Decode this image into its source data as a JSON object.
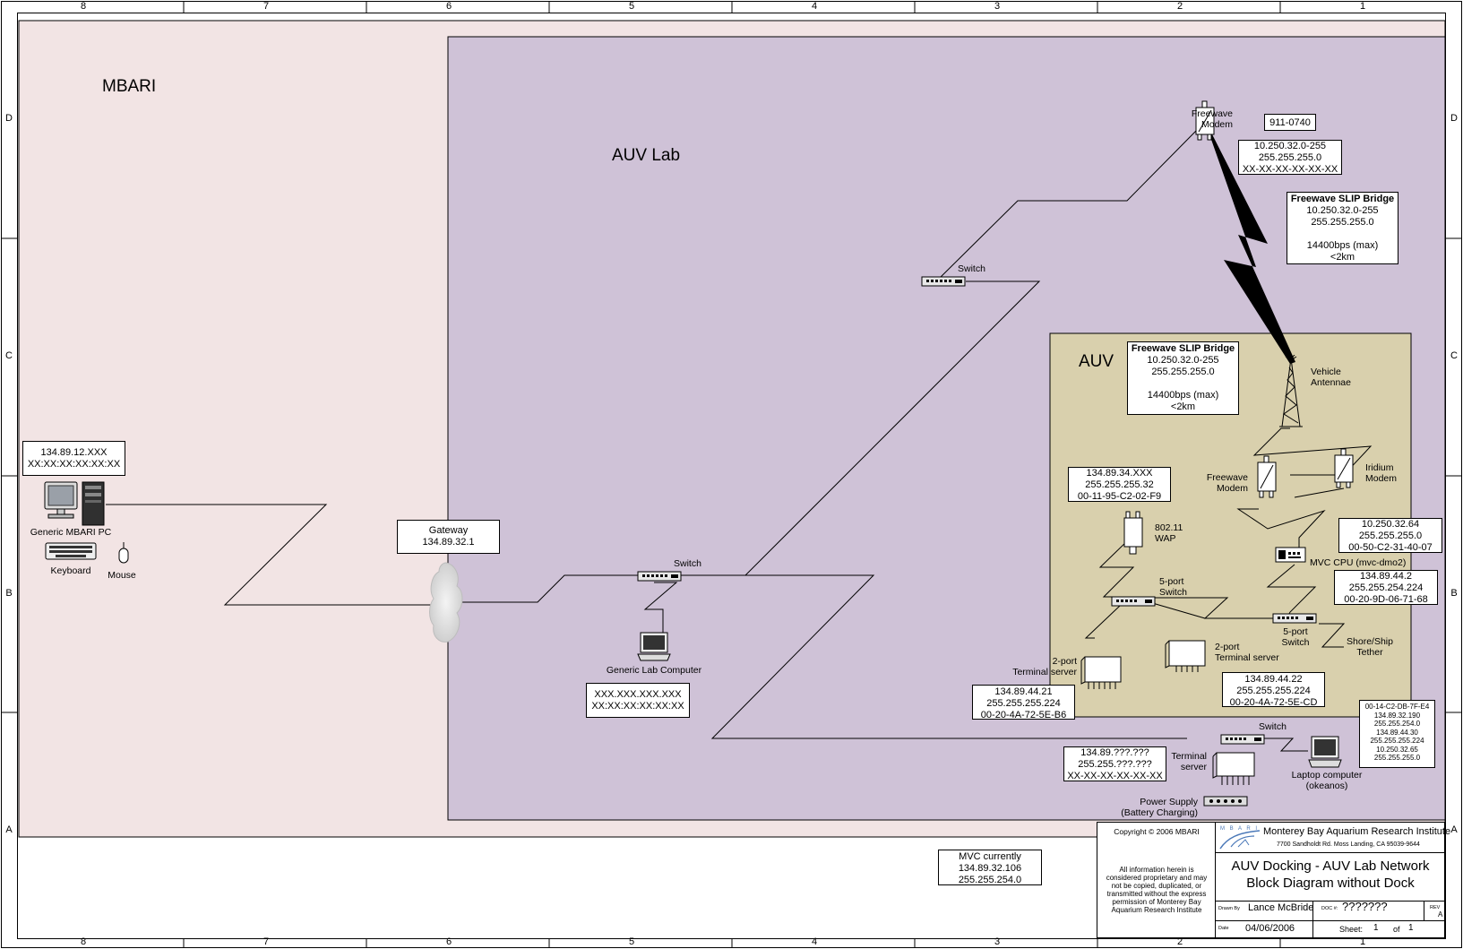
{
  "grid": {
    "columns": [
      "8",
      "7",
      "6",
      "5",
      "4",
      "3",
      "2",
      "1"
    ],
    "rows": [
      "D",
      "C",
      "B",
      "A"
    ]
  },
  "zones": {
    "mbari": "MBARI",
    "auv_lab": "AUV Lab",
    "auv": "AUV"
  },
  "colors": {
    "mbari_zone": "#f2e4e4",
    "auv_lab_zone": "#cfc2d7",
    "auv_zone": "#d9d0ad"
  },
  "mbari_pc": {
    "info": [
      "134.89.12.XXX",
      "XX:XX:XX:XX:XX:XX"
    ],
    "pc_label": "Generic MBARI PC",
    "keyboard_label": "Keyboard",
    "mouse_label": "Mouse"
  },
  "gateway": {
    "info": [
      "Gateway",
      "134.89.32.1"
    ]
  },
  "lab_switch_upper": {
    "label": "Switch"
  },
  "lab_switch_lower": {
    "label": "Switch"
  },
  "lab_computer": {
    "label": "Generic Lab Computer",
    "info": [
      "XXX.XXX.XXX.XXX",
      "XX:XX:XX:XX:XX:XX"
    ]
  },
  "freewave_shore": {
    "label": [
      "Freewave",
      "Modem"
    ],
    "serial": "911-0740",
    "info": [
      "10.250.32.0-255",
      "255.255.255.0",
      "XX-XX-XX-XX-XX-XX"
    ]
  },
  "slip_bridge_outer": {
    "title": "Freewave SLIP Bridge",
    "lines": [
      "10.250.32.0-255",
      "255.255.255.0",
      "",
      "14400bps (max)",
      "<2km"
    ]
  },
  "slip_bridge_inner": {
    "title": "Freewave SLIP Bridge",
    "lines": [
      "10.250.32.0-255",
      "255.255.255.0",
      "",
      "14400bps (max)",
      "<2km"
    ]
  },
  "antenna": {
    "label": [
      "Vehicle",
      "Antennae"
    ]
  },
  "freewave_vehicle": {
    "label": [
      "Freewave",
      "Modem"
    ]
  },
  "iridium": {
    "label": [
      "Iridium",
      "Modem"
    ]
  },
  "wap": {
    "info": [
      "134.89.34.XXX",
      "255.255.255.32",
      "00-11-95-C2-02-F9"
    ],
    "label": [
      "802.11",
      "WAP"
    ]
  },
  "mvc_cpu": {
    "info_top": [
      "10.250.32.64",
      "255.255.255.0",
      "00-50-C2-31-40-07"
    ],
    "label": "MVC CPU (mvc-dmo2)",
    "info_bottom": [
      "134.89.44.2",
      "255.255.254.224",
      "00-20-9D-06-71-68"
    ]
  },
  "switch_5port_left": {
    "label": [
      "5-port",
      "Switch"
    ]
  },
  "switch_5port_right": {
    "label": [
      "5-port",
      "Switch"
    ]
  },
  "terminal_2port_a": {
    "label": [
      "2-port",
      "Terminal server"
    ],
    "info": [
      "134.89.44.21",
      "255.255.255.224",
      "00-20-4A-72-5E-B6"
    ]
  },
  "terminal_2port_b": {
    "label": [
      "2-port",
      "Terminal server"
    ],
    "info": [
      "134.89.44.22",
      "255.255.255.224",
      "00-20-4A-72-5E-CD"
    ]
  },
  "tether": {
    "label": [
      "Shore/Ship",
      "Tether"
    ]
  },
  "dock_switch": {
    "label": "Switch"
  },
  "dock_terminal": {
    "label": [
      "Terminal",
      "server"
    ],
    "info": [
      "134.89.???.???",
      "255.255.???.???",
      "XX-XX-XX-XX-XX-XX"
    ]
  },
  "laptop": {
    "label": [
      "Laptop computer",
      "(okeanos)"
    ],
    "info": [
      "00-14-C2-DB-7F-E4",
      "134.89.32.190",
      "255.255.254.0",
      "134.89.44.30",
      "255.255.255.224",
      "10.250.32.65",
      "255.255.255.0"
    ]
  },
  "power_supply": {
    "label": [
      "Power Supply",
      "(Battery Charging)"
    ]
  },
  "mvc_note": {
    "lines": [
      "MVC currently",
      "134.89.32.106",
      "255.255.254.0"
    ]
  },
  "title_block": {
    "copyright": "Copyright © 2006 MBARI",
    "notice": [
      "All information herein is",
      "considered proprietary and may",
      "not be copied, duplicated, or",
      "transmitted without the express",
      "permission of Monterey Bay",
      "Aquarium Research Institute"
    ],
    "logo_text": "M B A R I",
    "org": "Monterey Bay Aquarium Research Institute",
    "address": "7700 Sandholdt Rd.   Moss Landing, CA 95039-9644",
    "title": [
      "AUV Docking - AUV Lab Network",
      "Block Diagram without Dock"
    ],
    "drawn_by_label": "Drawn By",
    "drawn_by": "Lance McBride",
    "doc_label": "DOC #:",
    "doc": "???????",
    "rev_label": "REV",
    "rev": "A",
    "date_label": "Date",
    "date": "04/06/2006",
    "sheet_label": "Sheet:",
    "sheet": "1",
    "of_label": "of",
    "sheet_total": "1"
  }
}
